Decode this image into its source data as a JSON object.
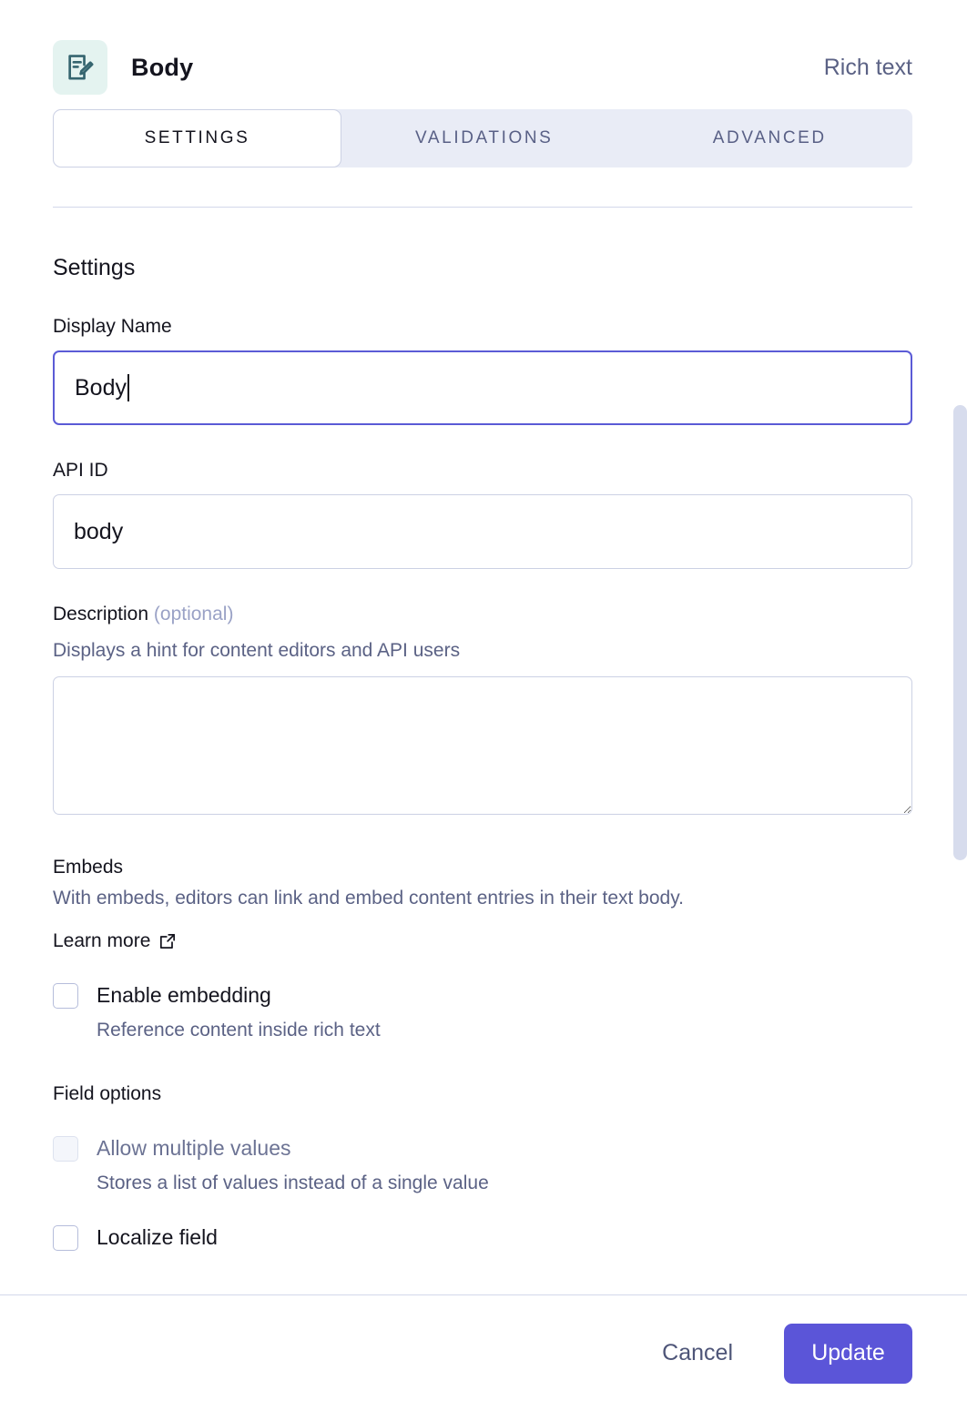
{
  "header": {
    "icon": "rich-text-document-edit-icon",
    "title": "Body",
    "field_type": "Rich text",
    "icon_bg_color": "#e4f3f0",
    "icon_color": "#35656f"
  },
  "tabs": [
    {
      "label": "SETTINGS",
      "active": true
    },
    {
      "label": "VALIDATIONS",
      "active": false
    },
    {
      "label": "ADVANCED",
      "active": false
    }
  ],
  "settings": {
    "section_title": "Settings",
    "display_name": {
      "label": "Display Name",
      "value": "Body",
      "placeholder": "",
      "focused": true
    },
    "api_id": {
      "label": "API ID",
      "value": "body",
      "placeholder": ""
    },
    "description": {
      "label": "Description",
      "optional_suffix": "(optional)",
      "helper": "Displays a hint for content editors and API users",
      "value": "",
      "placeholder": ""
    },
    "embeds": {
      "title": "Embeds",
      "helper": "With embeds, editors can link and embed content entries in their text body.",
      "learn_more_label": "Learn more",
      "learn_more_icon": "external-link-icon",
      "enable_embedding": {
        "label": "Enable embedding",
        "sub": "Reference content inside rich text",
        "checked": false,
        "disabled": false
      }
    },
    "field_options": {
      "title": "Field options",
      "allow_multiple_values": {
        "label": "Allow multiple values",
        "sub": "Stores a list of values instead of a single value",
        "checked": false,
        "disabled": true
      },
      "localize_field": {
        "label": "Localize field",
        "checked": false,
        "disabled": false
      }
    }
  },
  "footer": {
    "cancel_label": "Cancel",
    "update_label": "Update",
    "update_color": "#5b55d8"
  }
}
